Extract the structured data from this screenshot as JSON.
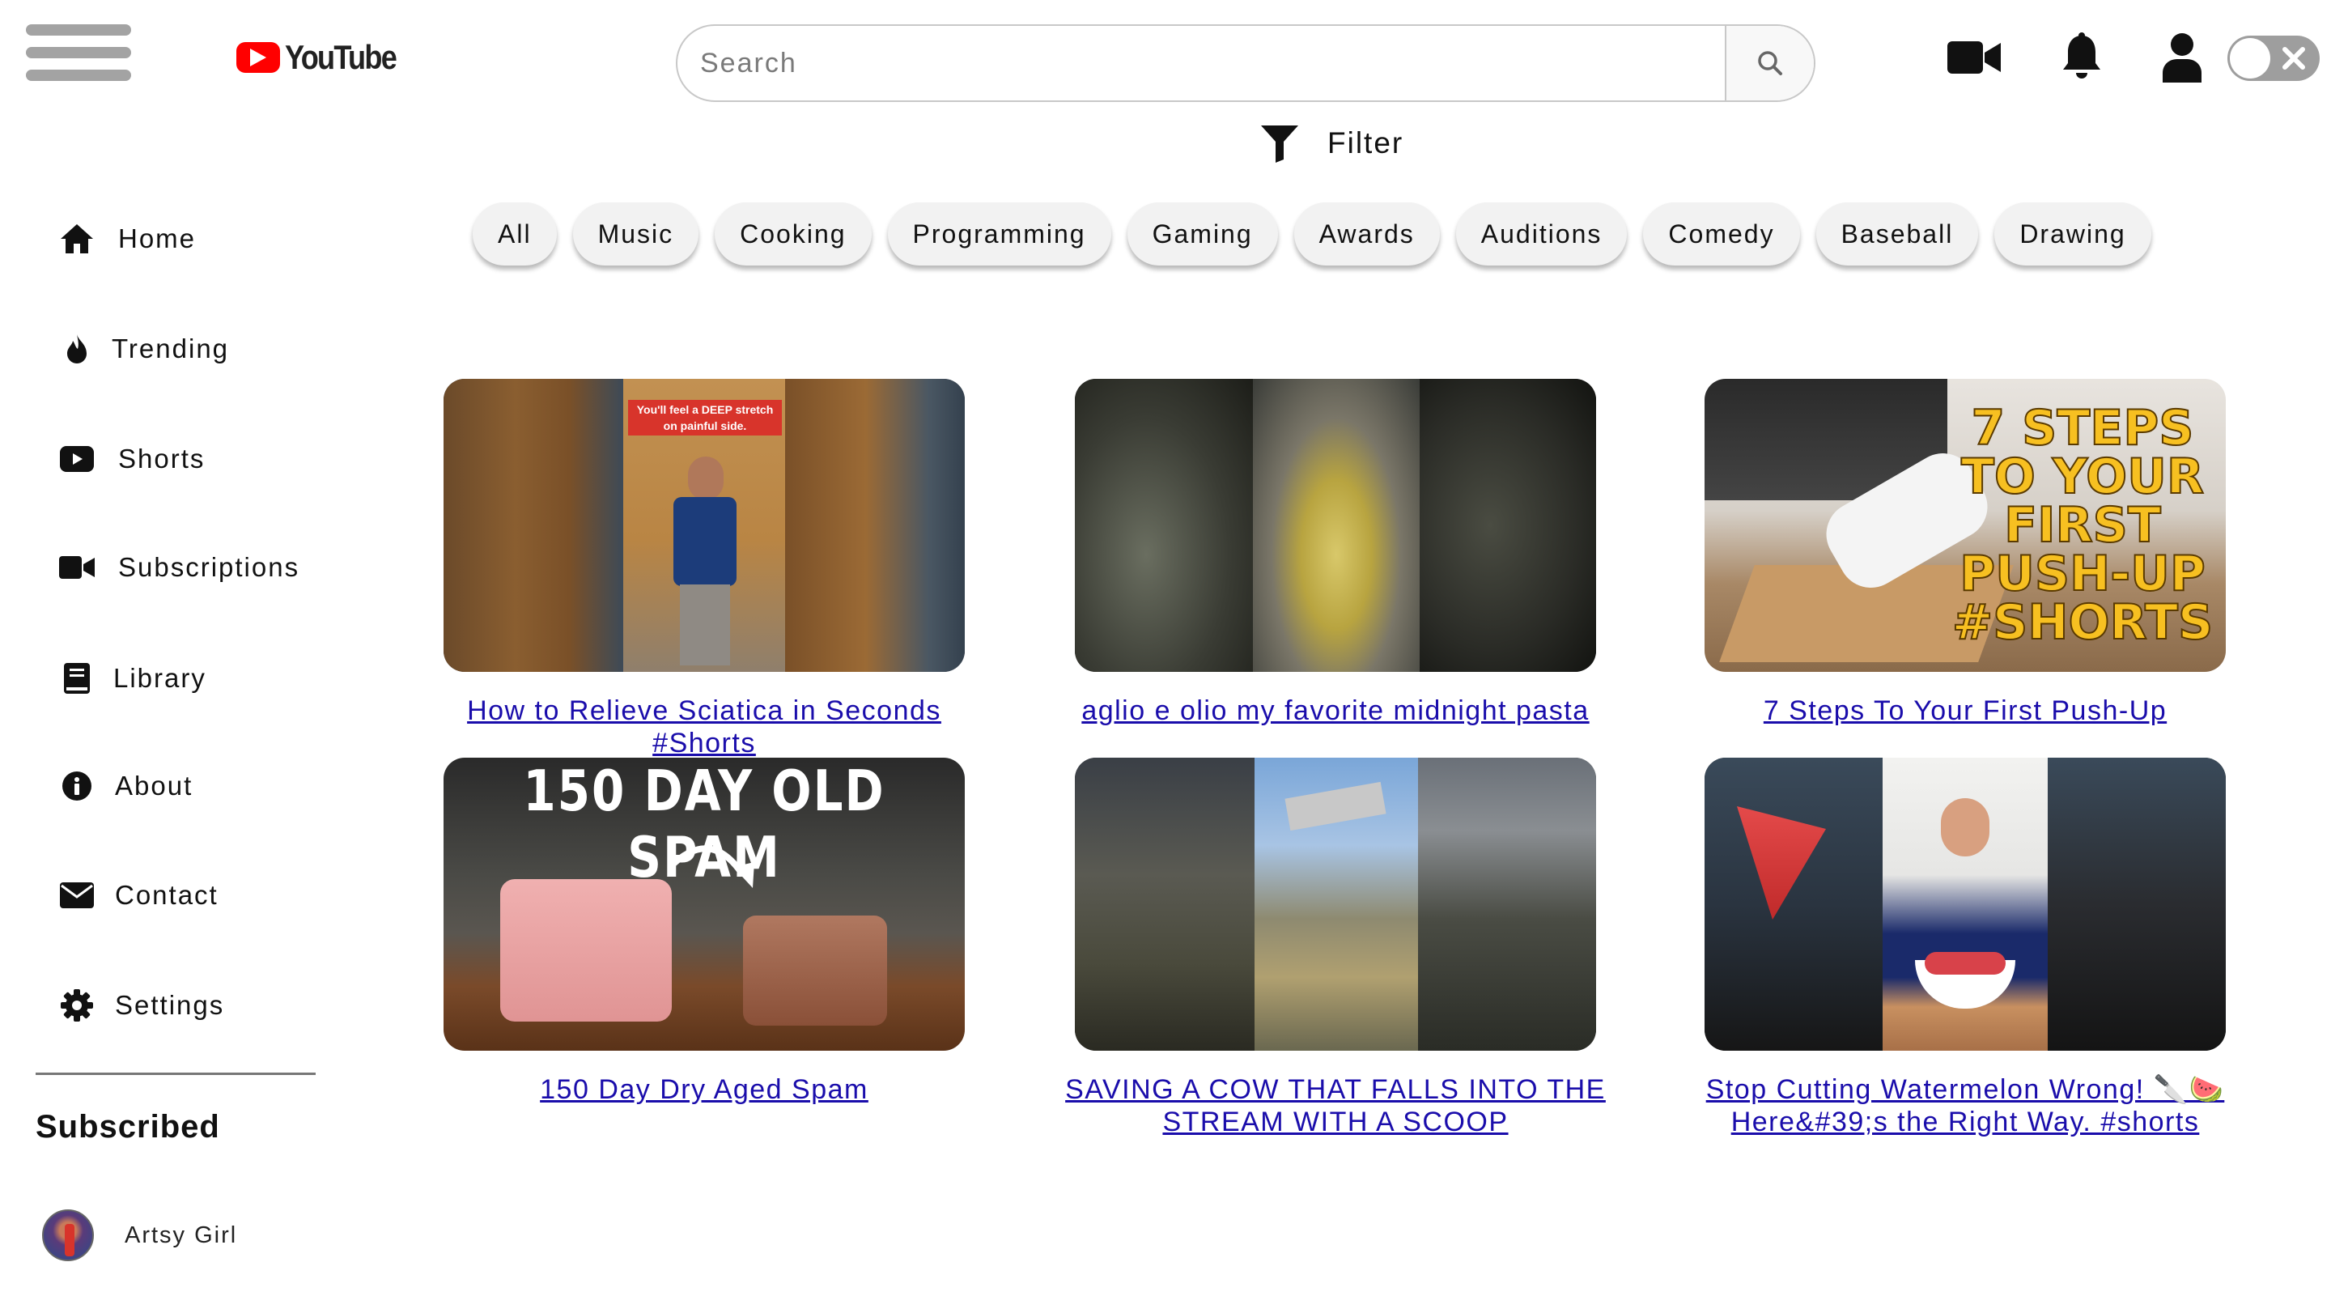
{
  "header": {
    "logo_text": "YouTube",
    "search_placeholder": "Search",
    "filter_label": "Filter"
  },
  "chips": [
    "All",
    "Music",
    "Cooking",
    "Programming",
    "Gaming",
    "Awards",
    "Auditions",
    "Comedy",
    "Baseball",
    "Drawing"
  ],
  "sidebar": {
    "items": [
      {
        "label": "Home",
        "icon": "home-icon"
      },
      {
        "label": "Trending",
        "icon": "fire-icon"
      },
      {
        "label": "Shorts",
        "icon": "play-icon"
      },
      {
        "label": "Subscriptions",
        "icon": "video-camera-icon"
      },
      {
        "label": "Library",
        "icon": "book-icon"
      },
      {
        "label": "About",
        "icon": "info-icon"
      },
      {
        "label": "Contact",
        "icon": "envelope-icon"
      },
      {
        "label": "Settings",
        "icon": "gear-icon"
      }
    ],
    "subscribed_heading": "Subscribed",
    "subscriptions": [
      {
        "name": "Artsy Girl"
      }
    ]
  },
  "videos": [
    {
      "title": "How to Relieve Sciatica in Seconds #Shorts",
      "thumb_text": "You'll feel a DEEP stretch on painful side."
    },
    {
      "title": "aglio e olio my favorite midnight pasta"
    },
    {
      "title": "7 Steps To Your First Push-Up",
      "thumb_text": "7 STEPS TO YOUR FIRST PUSH-UP #SHORTS"
    },
    {
      "title": "150 Day Dry Aged Spam",
      "thumb_text": "150 DAY OLD SPAM"
    },
    {
      "title": "SAVING A COW THAT FALLS INTO THE STREAM WITH A SCOOP"
    },
    {
      "title": "Stop Cutting Watermelon Wrong! 🔪🍉 Here&#39;s the Right Way. #shorts"
    }
  ],
  "colors": {
    "brand_red": "#ff0000",
    "link_blue": "#1a0dab",
    "chip_bg": "#f2f2f2"
  }
}
